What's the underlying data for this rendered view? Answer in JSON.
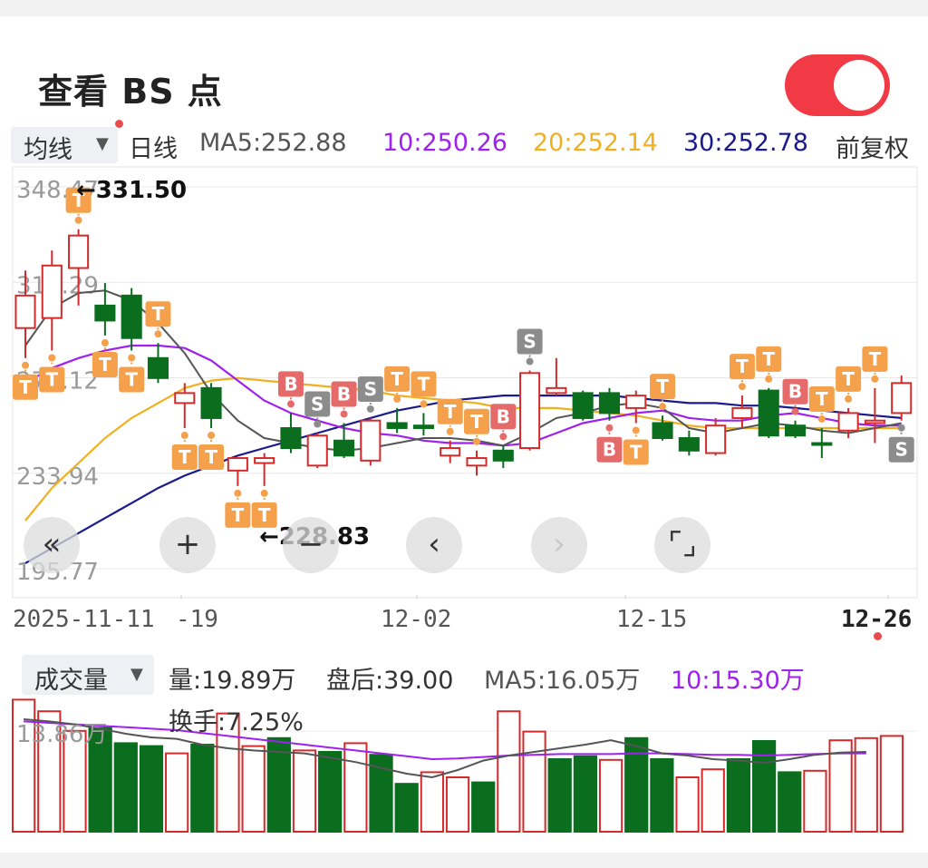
{
  "header": {
    "title": "查看 BS 点",
    "toggle_on": true,
    "toggle_color": "#f23a46"
  },
  "legend": {
    "dropdown_label": "均线",
    "period": "日线",
    "ma5": "MA5:252.88",
    "ma10": "10:250.26",
    "ma20": "20:252.14",
    "ma30": "30:252.78",
    "adjust": "前复权",
    "colors": {
      "ma5": "#555555",
      "ma10": "#a020f0",
      "ma20": "#f0b020",
      "ma30": "#1a1a8c",
      "up": "#d42a2a",
      "down": "#0b6e1f",
      "marker": "#f5a04a"
    }
  },
  "price_axis": {
    "labels": [
      "348.47",
      "310.29",
      "272.12",
      "233.94",
      "195.77"
    ]
  },
  "annotations": {
    "high": "←331.50",
    "low": "←228.83"
  },
  "x_axis": {
    "labels": [
      "2025-11-11",
      "-19",
      "12-02",
      "12-15",
      "12-26"
    ]
  },
  "controls": {
    "first_icon": "double-left-icon",
    "zoom_in_icon": "plus-icon",
    "zoom_out_icon": "minus-icon",
    "prev_icon": "chevron-left-icon",
    "next_icon": "chevron-right-icon",
    "fullscreen_icon": "fullscreen-icon"
  },
  "volume": {
    "dropdown_label": "成交量",
    "vol": "量:19.89万",
    "after_hours": "盘后:39.00",
    "ma5": "MA5:16.05万",
    "ma10": "10:15.30万",
    "turnover": "换手:7.25%",
    "axis_label": "13.86万"
  },
  "chart_data": {
    "type": "candlestick",
    "x_labels": [
      "2025-11-11",
      "-19",
      "12-02",
      "12-15",
      "12-26"
    ],
    "ylim": [
      195.77,
      348.47
    ],
    "y_ticks": [
      348.47,
      310.29,
      272.12,
      233.94,
      195.77
    ],
    "candles": [
      {
        "o": 292,
        "h": 315,
        "l": 280,
        "c": 305,
        "up": true
      },
      {
        "o": 296,
        "h": 323,
        "l": 283,
        "c": 317,
        "up": true
      },
      {
        "o": 316,
        "h": 331.5,
        "l": 301,
        "c": 329,
        "up": true
      },
      {
        "o": 301,
        "h": 310,
        "l": 289,
        "c": 295,
        "up": false
      },
      {
        "o": 305,
        "h": 308,
        "l": 283,
        "c": 288,
        "up": false
      },
      {
        "o": 280,
        "h": 286,
        "l": 270,
        "c": 272,
        "up": false
      },
      {
        "o": 262,
        "h": 270,
        "l": 252,
        "c": 266,
        "up": true
      },
      {
        "o": 268,
        "h": 270,
        "l": 252,
        "c": 256,
        "up": false
      },
      {
        "o": 235,
        "h": 240,
        "l": 228.83,
        "c": 240,
        "up": true
      },
      {
        "o": 238,
        "h": 242,
        "l": 228.83,
        "c": 240,
        "up": true
      },
      {
        "o": 252,
        "h": 258,
        "l": 242,
        "c": 244,
        "up": false
      },
      {
        "o": 237,
        "h": 250,
        "l": 236,
        "c": 249,
        "up": true
      },
      {
        "o": 247,
        "h": 254,
        "l": 240,
        "c": 241,
        "up": false
      },
      {
        "o": 239,
        "h": 256,
        "l": 237,
        "c": 255,
        "up": true
      },
      {
        "o": 254,
        "h": 260,
        "l": 250,
        "c": 252,
        "up": false
      },
      {
        "o": 253,
        "h": 258,
        "l": 249,
        "c": 252,
        "up": false
      },
      {
        "o": 241,
        "h": 247,
        "l": 238,
        "c": 244,
        "up": true
      },
      {
        "o": 237,
        "h": 243,
        "l": 233,
        "c": 240,
        "up": true
      },
      {
        "o": 243,
        "h": 245,
        "l": 236,
        "c": 239,
        "up": false
      },
      {
        "o": 244,
        "h": 275,
        "l": 243,
        "c": 274,
        "up": true
      },
      {
        "o": 266,
        "h": 280,
        "l": 265,
        "c": 268,
        "up": true
      },
      {
        "o": 266,
        "h": 267,
        "l": 255,
        "c": 256,
        "up": false
      },
      {
        "o": 266,
        "h": 268,
        "l": 255,
        "c": 258,
        "up": false
      },
      {
        "o": 260,
        "h": 267,
        "l": 254,
        "c": 265,
        "up": true
      },
      {
        "o": 254,
        "h": 257,
        "l": 247,
        "c": 248,
        "up": false
      },
      {
        "o": 248,
        "h": 251,
        "l": 241,
        "c": 243,
        "up": false
      },
      {
        "o": 242,
        "h": 256,
        "l": 241,
        "c": 253,
        "up": true
      },
      {
        "o": 256,
        "h": 265,
        "l": 252,
        "c": 260,
        "up": true
      },
      {
        "o": 267,
        "h": 268,
        "l": 248,
        "c": 249,
        "up": false
      },
      {
        "o": 253,
        "h": 255,
        "l": 248,
        "c": 249,
        "up": false
      },
      {
        "o": 246,
        "h": 252,
        "l": 240,
        "c": 246,
        "up": false
      },
      {
        "o": 251,
        "h": 260,
        "l": 248,
        "c": 258,
        "up": true
      },
      {
        "o": 254,
        "h": 268,
        "l": 246,
        "c": 255,
        "up": true
      },
      {
        "o": 258,
        "h": 273,
        "l": 255,
        "c": 270,
        "up": true
      }
    ],
    "ma5": [
      285,
      300,
      306,
      307,
      303,
      294,
      282,
      266,
      255,
      248,
      246,
      244,
      243,
      244,
      246,
      248,
      248,
      247,
      245,
      250,
      256,
      258,
      261,
      262,
      260,
      252,
      250,
      252,
      254,
      253,
      251,
      250,
      252,
      254
    ],
    "ma10": [
      270,
      276,
      280,
      283,
      285,
      285,
      284,
      279,
      271,
      263,
      258,
      255,
      252,
      250,
      249,
      247,
      246,
      246,
      245,
      246,
      250,
      254,
      256,
      258,
      259,
      256,
      255,
      255,
      257,
      258,
      256,
      254,
      253,
      253
    ],
    "ma20": [
      215,
      228,
      238,
      248,
      256,
      262,
      268,
      271,
      272,
      271,
      270,
      269,
      268,
      267,
      265,
      264,
      263,
      262,
      260,
      260,
      260,
      259,
      258,
      257,
      255,
      253,
      252,
      252,
      252,
      252,
      252,
      252,
      252,
      252
    ],
    "ma30": [
      198,
      204,
      210,
      216,
      222,
      228,
      233,
      237,
      241,
      244,
      247,
      250,
      253,
      256,
      259,
      261,
      263,
      264,
      265,
      265,
      265,
      265,
      265,
      264,
      263,
      262,
      262,
      261,
      261,
      260,
      259,
      258,
      257,
      256
    ],
    "volume": [
      18.2,
      16.6,
      13.9,
      14.3,
      12.2,
      11.8,
      10.8,
      12.0,
      16.3,
      11.8,
      12.9,
      11.2,
      11.0,
      12.2,
      10.6,
      6.6,
      8.2,
      7.5,
      6.8,
      16.6,
      13.8,
      10.0,
      10.4,
      9.9,
      12.9,
      10.0,
      7.5,
      8.6,
      10.0,
      12.5,
      8.2,
      8.4,
      12.6,
      12.9,
      13.2
    ],
    "vol_ma5": [
      15.5,
      15.2,
      14.8,
      14.2,
      13.5,
      13.0,
      12.8,
      12.0,
      11.5,
      11.2,
      11.0,
      10.8,
      10.2,
      9.6,
      8.8,
      8.0,
      7.5,
      8.5,
      9.8,
      10.5,
      11.0,
      11.5,
      12.0,
      12.6,
      11.8,
      10.8,
      10.5,
      10.0,
      9.8,
      9.5,
      10.0,
      10.6,
      10.9,
      11.0
    ],
    "vol_ma10": [
      15.2,
      15.0,
      14.8,
      14.6,
      14.4,
      14.2,
      14.0,
      13.6,
      13.2,
      12.8,
      12.4,
      12.0,
      11.6,
      11.2,
      10.8,
      10.4,
      10.0,
      10.1,
      10.3,
      10.5,
      10.6,
      10.7,
      10.7,
      10.7,
      10.8,
      10.8,
      10.7,
      10.6,
      10.6,
      10.5,
      10.6,
      10.7,
      10.8,
      10.8
    ],
    "signals": [
      {
        "i": 0,
        "t": "T",
        "dir": "down"
      },
      {
        "i": 1,
        "t": "T",
        "dir": "down"
      },
      {
        "i": 2,
        "t": "T",
        "dir": "up"
      },
      {
        "i": 3,
        "t": "T",
        "dir": "down"
      },
      {
        "i": 4,
        "t": "T",
        "dir": "down"
      },
      {
        "i": 5,
        "t": "T",
        "dir": "up"
      },
      {
        "i": 6,
        "t": "T",
        "dir": "down"
      },
      {
        "i": 7,
        "t": "T",
        "dir": "down"
      },
      {
        "i": 8,
        "t": "T",
        "dir": "down"
      },
      {
        "i": 9,
        "t": "T",
        "dir": "down"
      },
      {
        "i": 10,
        "t": "B",
        "dir": "up"
      },
      {
        "i": 11,
        "t": "S",
        "dir": "up"
      },
      {
        "i": 12,
        "t": "B",
        "dir": "up"
      },
      {
        "i": 13,
        "t": "S",
        "dir": "up"
      },
      {
        "i": 14,
        "t": "T",
        "dir": "up"
      },
      {
        "i": 15,
        "t": "T",
        "dir": "up"
      },
      {
        "i": 16,
        "t": "T",
        "dir": "up"
      },
      {
        "i": 17,
        "t": "T",
        "dir": "up"
      },
      {
        "i": 18,
        "t": "B",
        "dir": "up"
      },
      {
        "i": 19,
        "t": "S",
        "dir": "up"
      },
      {
        "i": 22,
        "t": "B",
        "dir": "down"
      },
      {
        "i": 23,
        "t": "T",
        "dir": "down"
      },
      {
        "i": 24,
        "t": "T",
        "dir": "up"
      },
      {
        "i": 27,
        "t": "T",
        "dir": "up"
      },
      {
        "i": 28,
        "t": "T",
        "dir": "up"
      },
      {
        "i": 29,
        "t": "B",
        "dir": "up"
      },
      {
        "i": 30,
        "t": "T",
        "dir": "up"
      },
      {
        "i": 31,
        "t": "T",
        "dir": "up"
      },
      {
        "i": 32,
        "t": "T",
        "dir": "up"
      },
      {
        "i": 33,
        "t": "S",
        "dir": "down"
      }
    ]
  }
}
